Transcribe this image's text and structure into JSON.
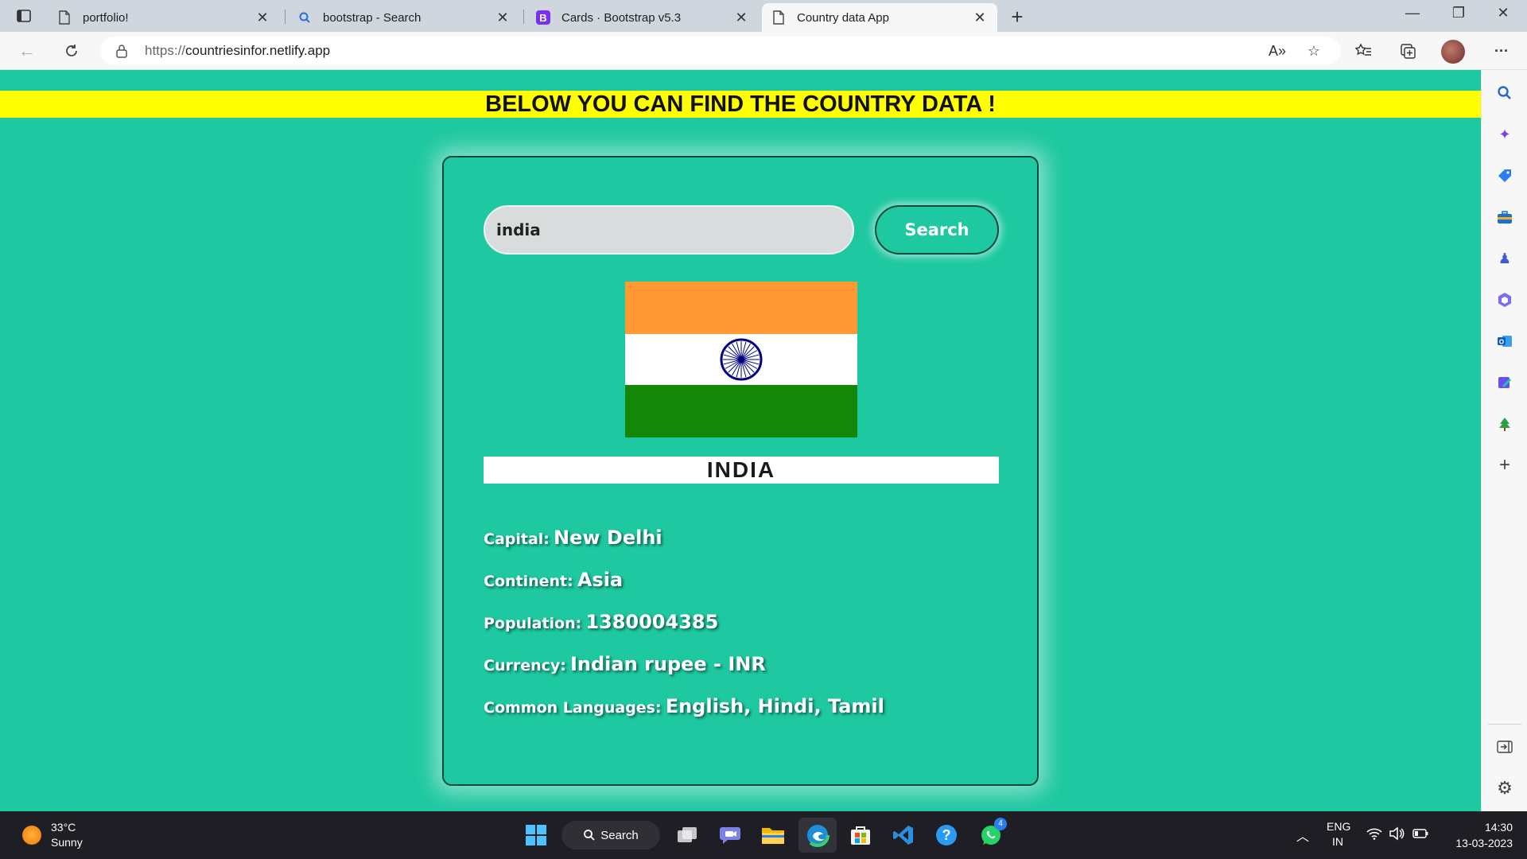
{
  "tabs": [
    {
      "label": "portfolio!",
      "icon": "page-icon"
    },
    {
      "label": "bootstrap - Search",
      "icon": "search-icon"
    },
    {
      "label": "Cards · Bootstrap v5.3",
      "icon": "bootstrap-icon"
    },
    {
      "label": "Country data App",
      "icon": "page-icon",
      "active": true
    }
  ],
  "address": {
    "protocol": "https://",
    "host": "countriesinfor.netlify.app"
  },
  "page": {
    "banner": "BELOW YOU CAN FIND THE COUNTRY DATA !",
    "search_value": "india",
    "search_button": "Search",
    "country_name": "INDIA",
    "info": [
      {
        "label": "Capital:",
        "value": "New Delhi"
      },
      {
        "label": "Continent:",
        "value": "Asia"
      },
      {
        "label": "Population:",
        "value": "1380004385"
      },
      {
        "label": "Currency:",
        "value": "Indian rupee - INR"
      },
      {
        "label": "Common Languages:",
        "value": "English, Hindi, Tamil"
      }
    ],
    "flag_colors": {
      "saffron": "#ff9933",
      "white": "#ffffff",
      "green": "#138808",
      "chakra": "#000080"
    }
  },
  "taskbar": {
    "temperature": "33°C",
    "weather": "Sunny",
    "search_label": "Search",
    "whatsapp_badge": "4",
    "lang_line1": "ENG",
    "lang_line2": "IN",
    "time": "14:30",
    "date": "13-03-2023"
  },
  "colors": {
    "page_bg": "#1ec8a0",
    "banner_bg": "#ffff00",
    "card_border": "#0f4a3d"
  }
}
